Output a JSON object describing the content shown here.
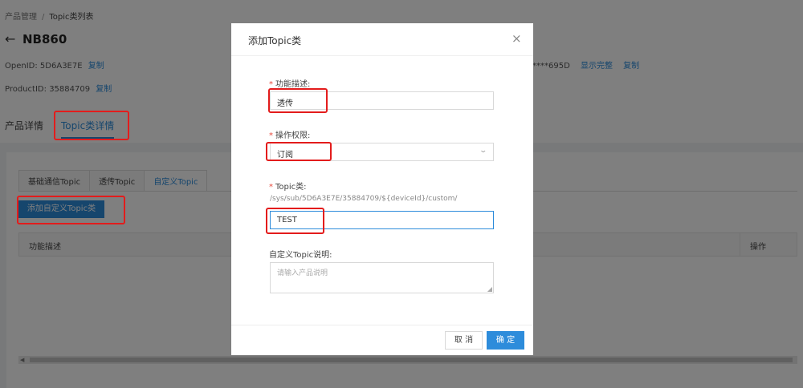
{
  "breadcrumb": {
    "root": "产品管理",
    "separator": "/",
    "current": "Topic类列表"
  },
  "product": {
    "name": "NB860"
  },
  "info": {
    "openid_label": "OpenID:",
    "openid_value": "5D6A3E7E",
    "openid_copy": "复制",
    "productid_label": "ProductID:",
    "productid_value": "35884709",
    "productid_copy": "复制",
    "secret_masked": "****695D",
    "secret_show_full": "显示完整",
    "secret_copy": "复制"
  },
  "main_tabs": [
    {
      "label": "产品详情",
      "active": false
    },
    {
      "label": "Topic类详情",
      "active": true
    }
  ],
  "sub_tabs": [
    {
      "label": "基础通信Topic",
      "active": false
    },
    {
      "label": "透传Topic",
      "active": false
    },
    {
      "label": "自定义Topic",
      "active": true
    }
  ],
  "add_button_label": "添加自定义Topic类",
  "table": {
    "columns": [
      "功能描述",
      "操作"
    ]
  },
  "modal": {
    "title": "添加Topic类",
    "close_icon": "×",
    "fields": {
      "func_desc": {
        "required_mark": "*",
        "label": "功能描述:",
        "value": "透传"
      },
      "permission": {
        "required_mark": "*",
        "label": "操作权限:",
        "value": "订阅"
      },
      "topic": {
        "required_mark": "*",
        "label": "Topic类:",
        "prefix": "/sys/sub/5D6A3E7E/35884709/${deviceId}/custom/",
        "value": "TEST"
      },
      "desc": {
        "label": "自定义Topic说明:",
        "placeholder": "请输入产品说明"
      }
    },
    "cancel_label": "取 消",
    "ok_label": "确 定"
  },
  "colors": {
    "accent": "#2d8cdb",
    "highlight": "#e31c1c",
    "required": "#e8473a"
  },
  "icons": {
    "back": "arrow-left-icon",
    "close": "close-icon",
    "dropdown": "chevron-down-icon"
  }
}
